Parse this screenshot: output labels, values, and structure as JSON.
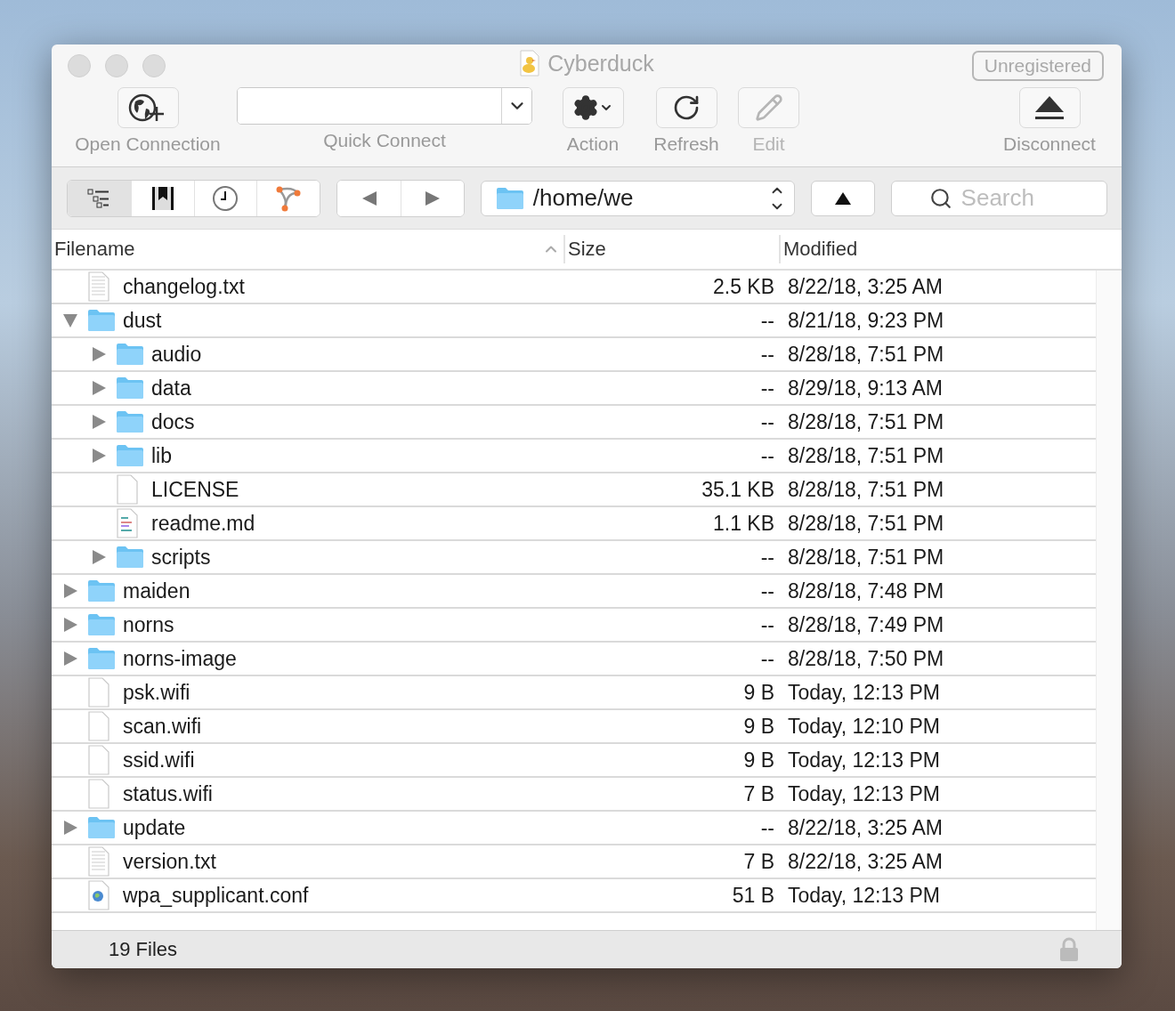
{
  "window": {
    "title": "Cyberduck",
    "badge": "Unregistered"
  },
  "toolbar": [
    {
      "kind": "open",
      "label": "Open Connection",
      "disabled": false
    },
    {
      "kind": "quick",
      "label": "Quick Connect",
      "disabled": false
    },
    {
      "kind": "action",
      "label": "Action",
      "disabled": false
    },
    {
      "kind": "refresh",
      "label": "Refresh",
      "disabled": false
    },
    {
      "kind": "edit",
      "label": "Edit",
      "disabled": true
    },
    {
      "kind": "disconnect",
      "label": "Disconnect",
      "disabled": false
    }
  ],
  "view_switcher": [
    {
      "kind": "outline",
      "selected": true
    },
    {
      "kind": "bookmarks",
      "selected": false
    },
    {
      "kind": "history",
      "selected": false
    },
    {
      "kind": "bonjour",
      "selected": false
    }
  ],
  "path": "/home/we",
  "search": {
    "placeholder": "Search"
  },
  "columns": [
    "Filename",
    "Size",
    "Modified"
  ],
  "files": [
    {
      "kind": "text",
      "name": "changelog.txt",
      "size": "2.5 KB",
      "modified": "8/22/18, 3:25 AM"
    },
    {
      "kind": "folder",
      "name": "dust",
      "size": "--",
      "modified": "8/21/18, 9:23 PM",
      "expanded": true,
      "children": [
        {
          "kind": "folder",
          "name": "audio",
          "size": "--",
          "modified": "8/28/18, 7:51 PM",
          "expanded": false
        },
        {
          "kind": "folder",
          "name": "data",
          "size": "--",
          "modified": "8/29/18, 9:13 AM",
          "expanded": false
        },
        {
          "kind": "folder",
          "name": "docs",
          "size": "--",
          "modified": "8/28/18, 7:51 PM",
          "expanded": false
        },
        {
          "kind": "folder",
          "name": "lib",
          "size": "--",
          "modified": "8/28/18, 7:51 PM",
          "expanded": false
        },
        {
          "kind": "blank",
          "name": "LICENSE",
          "size": "35.1 KB",
          "modified": "8/28/18, 7:51 PM"
        },
        {
          "kind": "markdown",
          "name": "readme.md",
          "size": "1.1 KB",
          "modified": "8/28/18, 7:51 PM"
        },
        {
          "kind": "folder",
          "name": "scripts",
          "size": "--",
          "modified": "8/28/18, 7:51 PM",
          "expanded": false
        }
      ]
    },
    {
      "kind": "folder",
      "name": "maiden",
      "size": "--",
      "modified": "8/28/18, 7:48 PM",
      "expanded": false
    },
    {
      "kind": "folder",
      "name": "norns",
      "size": "--",
      "modified": "8/28/18, 7:49 PM",
      "expanded": false
    },
    {
      "kind": "folder",
      "name": "norns-image",
      "size": "--",
      "modified": "8/28/18, 7:50 PM",
      "expanded": false
    },
    {
      "kind": "blank",
      "name": "psk.wifi",
      "size": "9 B",
      "modified": "Today, 12:13 PM"
    },
    {
      "kind": "blank",
      "name": "scan.wifi",
      "size": "9 B",
      "modified": "Today, 12:10 PM"
    },
    {
      "kind": "blank",
      "name": "ssid.wifi",
      "size": "9 B",
      "modified": "Today, 12:13 PM"
    },
    {
      "kind": "blank",
      "name": "status.wifi",
      "size": "7 B",
      "modified": "Today, 12:13 PM"
    },
    {
      "kind": "folder",
      "name": "update",
      "size": "--",
      "modified": "8/22/18, 3:25 AM",
      "expanded": false
    },
    {
      "kind": "text",
      "name": "version.txt",
      "size": "7 B",
      "modified": "8/22/18, 3:25 AM"
    },
    {
      "kind": "config",
      "name": "wpa_supplicant.conf",
      "size": "51 B",
      "modified": "Today, 12:13 PM"
    }
  ],
  "status_bar": "19 Files"
}
